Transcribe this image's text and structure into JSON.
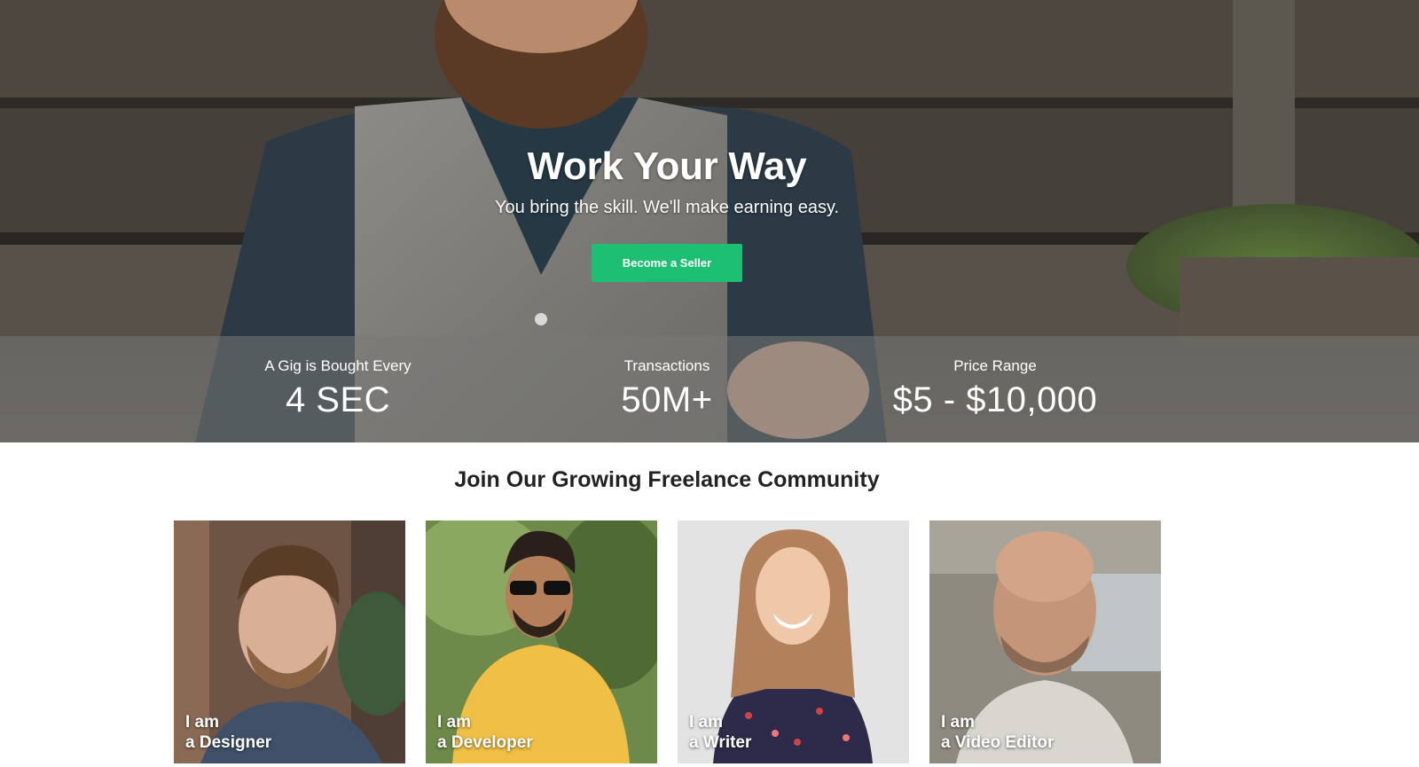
{
  "hero": {
    "title": "Work Your Way",
    "subtitle": "You bring the skill. We'll make earning easy.",
    "cta_label": "Become a Seller"
  },
  "stats": [
    {
      "label": "A Gig is Bought Every",
      "value": "4 SEC"
    },
    {
      "label": "Transactions",
      "value": "50M+"
    },
    {
      "label": "Price Range",
      "value": "$5 - $10,000"
    }
  ],
  "community": {
    "title": "Join Our Growing Freelance Community",
    "cards": [
      {
        "line1": "I am",
        "line2": "a Designer"
      },
      {
        "line1": "I am",
        "line2": "a Developer"
      },
      {
        "line1": "I am",
        "line2": "a Writer"
      },
      {
        "line1": "I am",
        "line2": "a Video Editor"
      }
    ]
  },
  "colors": {
    "accent": "#1dbf73",
    "stats_overlay": "rgba(120,120,118,0.55)"
  }
}
